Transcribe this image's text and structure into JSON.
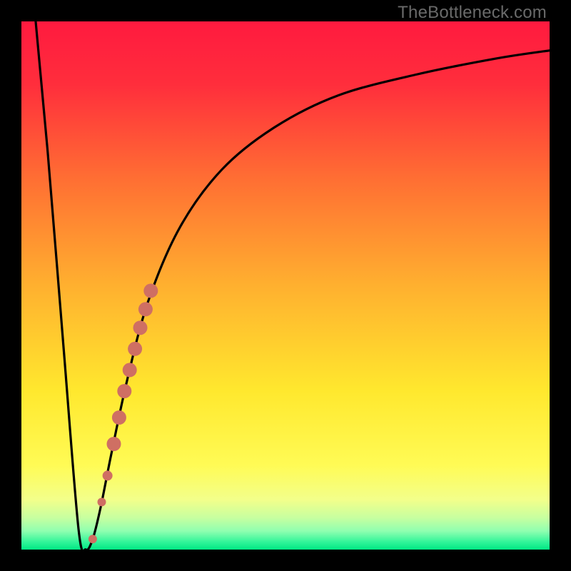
{
  "watermark": "TheBottleneck.com",
  "gradient_stops": [
    {
      "offset": 0.0,
      "color": "#ff1a3f"
    },
    {
      "offset": 0.12,
      "color": "#ff2e3c"
    },
    {
      "offset": 0.3,
      "color": "#ff6f33"
    },
    {
      "offset": 0.5,
      "color": "#ffb02f"
    },
    {
      "offset": 0.7,
      "color": "#ffe82e"
    },
    {
      "offset": 0.84,
      "color": "#fffb55"
    },
    {
      "offset": 0.905,
      "color": "#f3ff8a"
    },
    {
      "offset": 0.94,
      "color": "#c7ffa0"
    },
    {
      "offset": 0.965,
      "color": "#8fffb0"
    },
    {
      "offset": 0.985,
      "color": "#34f59a"
    },
    {
      "offset": 1.0,
      "color": "#00e884"
    }
  ],
  "chart_data": {
    "type": "line",
    "title": "",
    "xlabel": "",
    "ylabel": "",
    "xlim": [
      0,
      100
    ],
    "ylim": [
      0,
      100
    ],
    "series": [
      {
        "name": "bottleneck-curve",
        "x": [
          2.7,
          5,
          8,
          10.8,
          12.2,
          13.5,
          15,
          17,
          20,
          24,
          30,
          38,
          48,
          60,
          75,
          90,
          100
        ],
        "y": [
          100,
          75,
          38,
          4,
          0,
          2,
          8,
          18,
          32,
          47,
          61,
          72,
          80,
          86,
          90,
          93,
          94.5
        ]
      }
    ],
    "markers": {
      "name": "highlight-dots",
      "color": "#cf6f63",
      "points": [
        {
          "x": 13.5,
          "y": 2,
          "r": 6
        },
        {
          "x": 15.2,
          "y": 9,
          "r": 6
        },
        {
          "x": 16.3,
          "y": 14,
          "r": 7
        },
        {
          "x": 17.5,
          "y": 20,
          "r": 10
        },
        {
          "x": 18.5,
          "y": 25,
          "r": 10
        },
        {
          "x": 19.5,
          "y": 30,
          "r": 10
        },
        {
          "x": 20.5,
          "y": 34,
          "r": 10
        },
        {
          "x": 21.5,
          "y": 38,
          "r": 10
        },
        {
          "x": 22.5,
          "y": 42,
          "r": 10
        },
        {
          "x": 23.5,
          "y": 45.5,
          "r": 10
        },
        {
          "x": 24.5,
          "y": 49,
          "r": 10
        }
      ]
    }
  }
}
